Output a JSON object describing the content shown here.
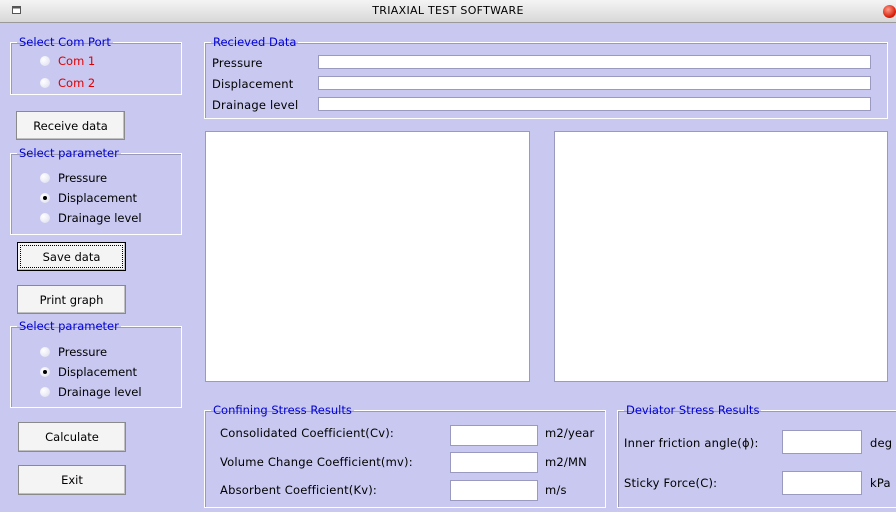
{
  "window": {
    "title": "TRIAXIAL TEST SOFTWARE",
    "window_icon": "window-icon",
    "close_icon": "close-icon",
    "close_color": "#e02010"
  },
  "com_port": {
    "legend": "Select Com Port",
    "options": [
      {
        "label": "Com 1",
        "selected": false
      },
      {
        "label": "Com 2",
        "selected": false
      }
    ]
  },
  "received": {
    "legend": "Recieved Data",
    "pressure_label": "Pressure",
    "displacement_label": "Displacement",
    "drainage_label": "Drainage level",
    "pressure_value": "",
    "displacement_value": "",
    "drainage_value": ""
  },
  "buttons": {
    "receive": "Receive data",
    "save": "Save data",
    "print": "Print graph",
    "calculate": "Calculate",
    "exit": "Exit"
  },
  "param1": {
    "legend": "Select parameter",
    "options": [
      {
        "label": "Pressure",
        "selected": false
      },
      {
        "label": "Displacement",
        "selected": true
      },
      {
        "label": "Drainage level",
        "selected": false
      }
    ]
  },
  "param2": {
    "legend": "Select parameter",
    "options": [
      {
        "label": "Pressure",
        "selected": false
      },
      {
        "label": "Displacement",
        "selected": true
      },
      {
        "label": "Drainage level",
        "selected": false
      }
    ]
  },
  "confining": {
    "legend": "Confining Stress Results",
    "rows": [
      {
        "label": "Consolidated Coefficient(Cv):",
        "value": "",
        "unit": "m2/year"
      },
      {
        "label": "Volume Change Coefficient(mv):",
        "value": "",
        "unit": "m2/MN"
      },
      {
        "label": "Absorbent Coefficient(Kv):",
        "value": "",
        "unit": "m/s"
      }
    ]
  },
  "deviator": {
    "legend": "Deviator Stress Results",
    "rows": [
      {
        "label": "Inner friction angle(ϕ):",
        "value": "",
        "unit": "deg"
      },
      {
        "label": "Sticky Force(C):",
        "value": "",
        "unit": "kPa"
      }
    ]
  },
  "colors": {
    "background": "#c8c8f0",
    "legend_text": "#0000d0",
    "com_text": "#e00000"
  }
}
